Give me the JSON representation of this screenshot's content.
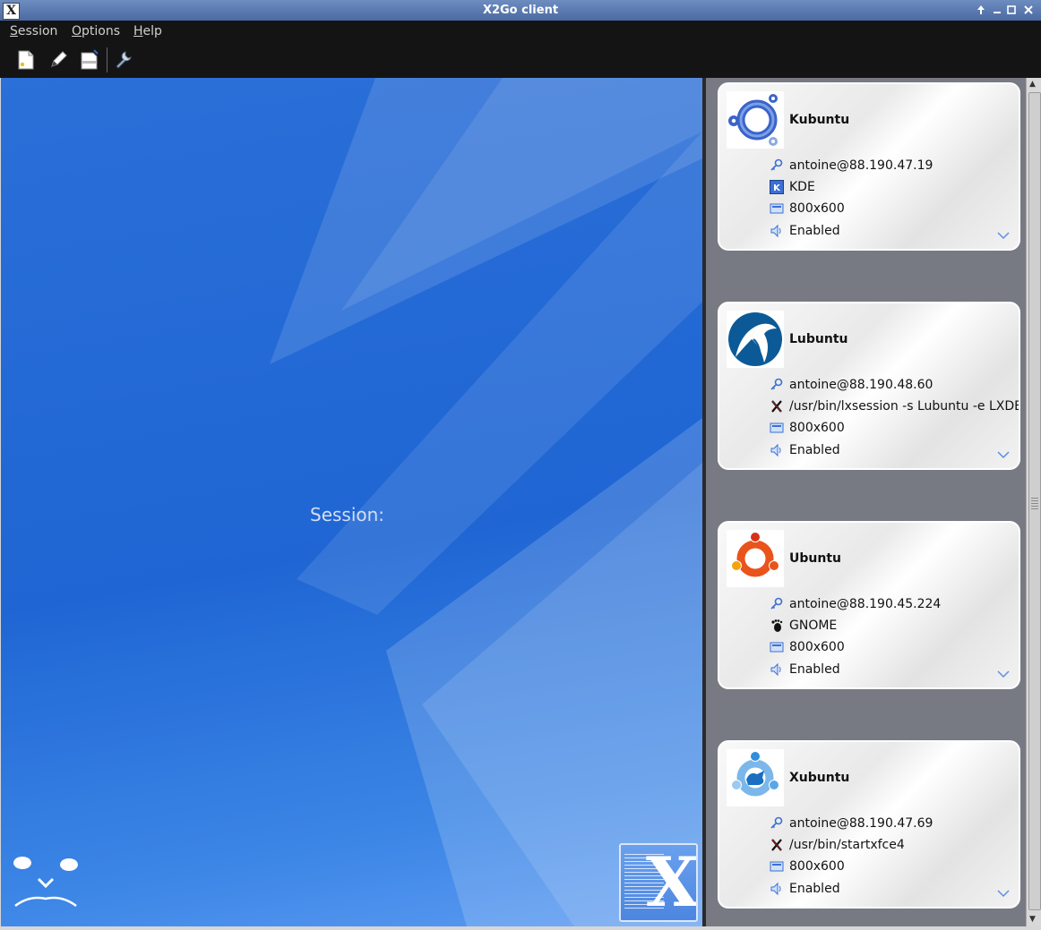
{
  "window": {
    "title": "X2Go client",
    "app_icon": "X"
  },
  "menubar": {
    "items": [
      {
        "accel": "S",
        "rest": "ession"
      },
      {
        "accel": "O",
        "rest": "ptions"
      },
      {
        "accel": "H",
        "rest": "elp"
      }
    ]
  },
  "toolbar": {
    "buttons": [
      "new-session-icon",
      "edit-session-icon",
      "session-management-icon",
      "settings-wrench-icon"
    ]
  },
  "main": {
    "session_label": "Session:"
  },
  "sessions": [
    {
      "name": "Kubuntu",
      "connection": "antoine@88.190.47.19",
      "command": "KDE",
      "command_icon": "kde-icon",
      "geometry": "800x600",
      "sound": "Enabled"
    },
    {
      "name": "Lubuntu",
      "connection": "antoine@88.190.48.60",
      "command": "/usr/bin/lxsession -s Lubuntu -e LXDE",
      "command_icon": "x-command-icon",
      "geometry": "800x600",
      "sound": "Enabled"
    },
    {
      "name": "Ubuntu",
      "connection": "antoine@88.190.45.224",
      "command": "GNOME",
      "command_icon": "gnome-foot-icon",
      "geometry": "800x600",
      "sound": "Enabled"
    },
    {
      "name": "Xubuntu",
      "connection": "antoine@88.190.47.69",
      "command": "/usr/bin/startxfce4",
      "command_icon": "x-command-icon",
      "geometry": "800x600",
      "sound": "Enabled"
    }
  ],
  "colors": {
    "desktop_blue": "#1f66d4",
    "panel_gray": "#777a83",
    "menubar": "#141414"
  }
}
